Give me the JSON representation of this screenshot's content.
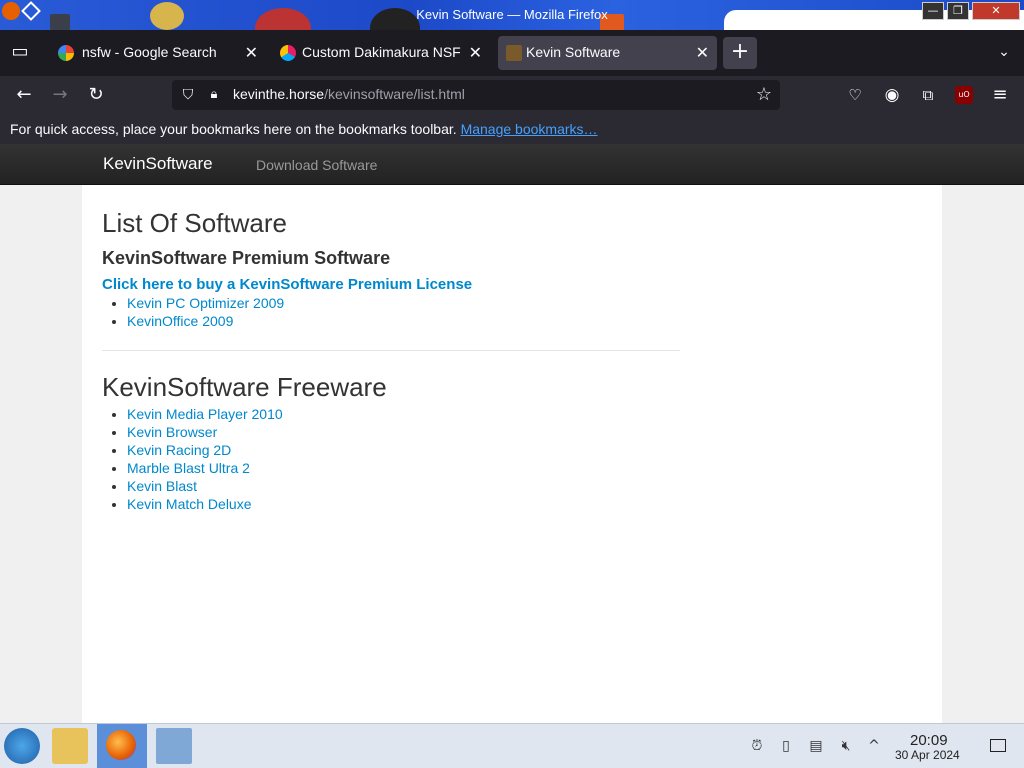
{
  "window": {
    "title": "Kevin Software — Mozilla Firefox"
  },
  "tabs": [
    {
      "label": "nsfw - Google Search",
      "favicon": "google-icon"
    },
    {
      "label": "Custom Dakimakura NSF",
      "favicon": "color-wheel-icon"
    },
    {
      "label": "Kevin Software",
      "favicon": "kevin-icon",
      "active": true
    }
  ],
  "urlbar": {
    "domain": "kevinthe.horse",
    "path": "/kevinsoftware/list.html"
  },
  "bookmarks_bar": {
    "message": "For quick access, place your bookmarks here on the bookmarks toolbar.",
    "link": "Manage bookmarks…"
  },
  "site": {
    "brand": "KevinSoftware",
    "nav_link": "Download Software",
    "heading": "List Of Software",
    "premium": {
      "title": "KevinSoftware Premium Software",
      "buy_link": "Click here to buy a KevinSoftware Premium License",
      "items": [
        "Kevin PC Optimizer 2009",
        "KevinOffice 2009"
      ]
    },
    "freeware": {
      "title": "KevinSoftware Freeware",
      "items": [
        "Kevin Media Player 2010",
        "Kevin Browser",
        "Kevin Racing 2D",
        "Marble Blast Ultra 2",
        "Kevin Blast",
        "Kevin Match Deluxe"
      ]
    }
  },
  "taskbar": {
    "time": "20:09",
    "date": "30 Apr 2024"
  },
  "colors": {
    "link": "#0088cc",
    "tab_bg": "#1c1b22",
    "toolbar_bg": "#2b2a33"
  }
}
